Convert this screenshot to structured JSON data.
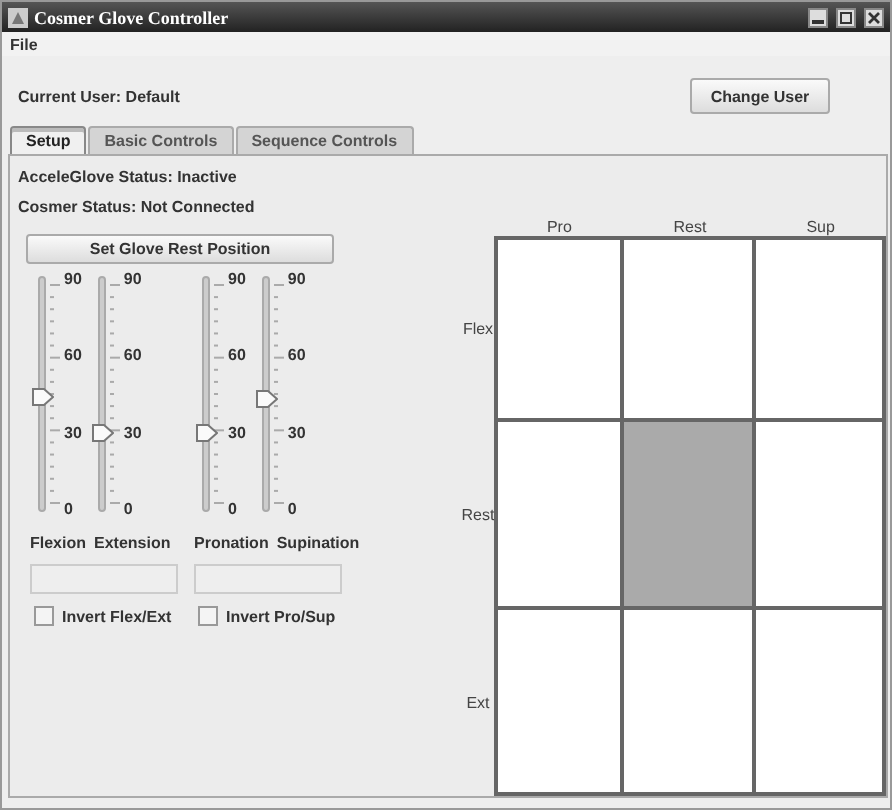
{
  "window": {
    "title": "Cosmer Glove Controller"
  },
  "menu": [
    "File"
  ],
  "current_user": "Current User: Default",
  "change_user_button": "Change User",
  "tabs": [
    {
      "label": "Setup",
      "selected": true
    },
    {
      "label": "Basic Controls",
      "selected": false
    },
    {
      "label": "Sequence Controls",
      "selected": false
    }
  ],
  "statuses": [
    "AcceleGlove Status: Inactive",
    "Cosmer Status: Not Connected"
  ],
  "rest_button": "Set Glove Rest Position",
  "slider_groups": [
    {
      "sliders": [
        {
          "name": "Flexion",
          "level": 0.5,
          "ticks": [
            "90",
            "60",
            "30",
            "0"
          ]
        },
        {
          "name": "Extension",
          "level": 0.33,
          "ticks": [
            "90",
            "60",
            "30",
            "0"
          ]
        }
      ],
      "checkbox": {
        "label": "Invert Flex/Ext",
        "checked": false
      }
    },
    {
      "sliders": [
        {
          "name": "Pronation",
          "level": 0.33,
          "ticks": [
            "90",
            "60",
            "30",
            "0"
          ]
        },
        {
          "name": "Supination",
          "level": 0.49,
          "ticks": [
            "90",
            "60",
            "30",
            "0"
          ]
        }
      ],
      "checkbox": {
        "label": "Invert Pro/Sup",
        "checked": false
      }
    }
  ],
  "grid": {
    "columns": [
      "Pro",
      "Rest",
      "Sup"
    ],
    "rows": [
      {
        "label": "Flex",
        "cells": [
          {
            "selected": false
          },
          {
            "selected": false
          },
          {
            "selected": false
          }
        ]
      },
      {
        "label": "Rest",
        "cells": [
          {
            "selected": false
          },
          {
            "selected": true
          },
          {
            "selected": false
          }
        ]
      },
      {
        "label": "Ext",
        "cells": [
          {
            "selected": false
          },
          {
            "selected": false
          },
          {
            "selected": false
          }
        ]
      }
    ]
  }
}
